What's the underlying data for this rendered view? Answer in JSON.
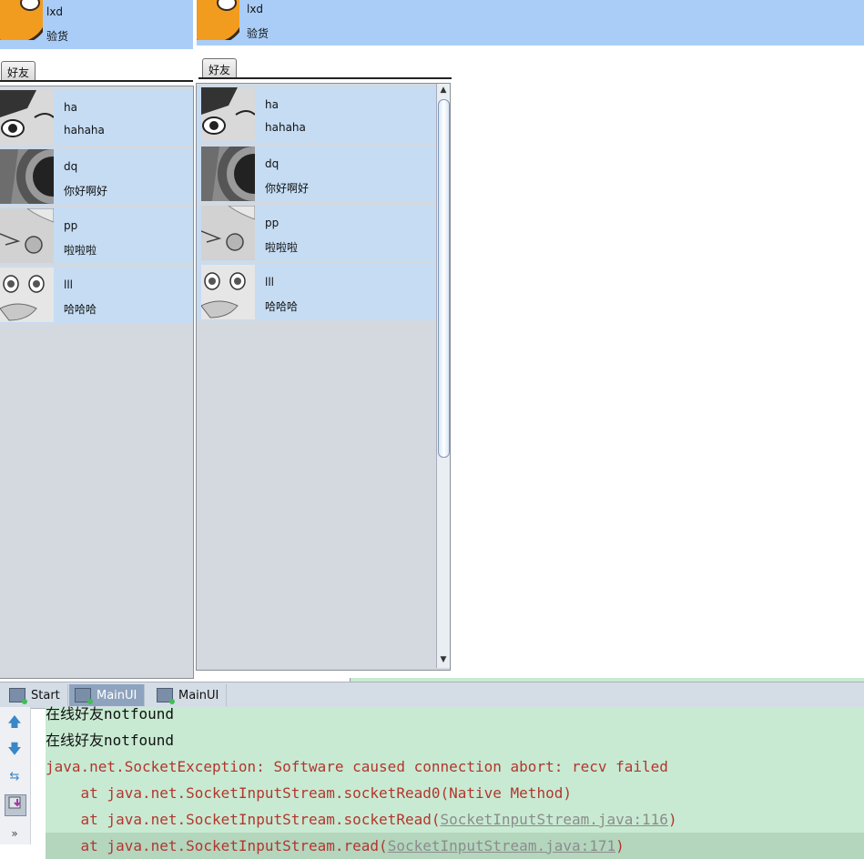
{
  "windows": [
    {
      "header": {
        "name": "lxd",
        "signature": "验货"
      },
      "tab_label": "好友",
      "friends": [
        {
          "name": "ha",
          "status": "hahaha"
        },
        {
          "name": "dq",
          "status": "你好啊好"
        },
        {
          "name": "pp",
          "status": "啦啦啦"
        },
        {
          "name": "lll",
          "status": "哈哈哈"
        }
      ]
    },
    {
      "header": {
        "name": "lxd",
        "signature": "验货"
      },
      "tab_label": "好友",
      "friends": [
        {
          "name": "ha",
          "status": "hahaha"
        },
        {
          "name": "dq",
          "status": "你好啊好"
        },
        {
          "name": "pp",
          "status": "啦啦啦"
        },
        {
          "name": "lll",
          "status": "哈哈哈"
        }
      ]
    }
  ],
  "run_panel": {
    "tabs": [
      {
        "label": "Start",
        "active": false
      },
      {
        "label": "MainUI",
        "active": true
      },
      {
        "label": "MainUI",
        "active": false
      }
    ],
    "console_lines": [
      {
        "prefix": "在线好友notfound",
        "link": "",
        "suffix": ""
      },
      {
        "prefix": "在线好友notfound",
        "link": "",
        "suffix": ""
      },
      {
        "prefix": "java.net.SocketException: Software caused connection abort: recv failed",
        "link": "",
        "suffix": ""
      },
      {
        "prefix": "    at java.net.SocketInputStream.socketRead0(Native Method)",
        "link": "",
        "suffix": ""
      },
      {
        "prefix": "    at java.net.SocketInputStream.socketRead(",
        "link": "SocketInputStream.java:116",
        "suffix": ")"
      },
      {
        "prefix": "    at java.net.SocketInputStream.read(",
        "link": "SocketInputStream.java:171",
        "suffix": ")"
      }
    ],
    "gutter_icons": [
      "arrow-up-icon",
      "arrow-down-icon",
      "soft-wrap-icon",
      "scroll-to-end-icon",
      "more-icon"
    ],
    "colors": {
      "console_bg": "#c8ead2",
      "error_text": "#b3362e",
      "header_bg": "#a9cdf7",
      "item_bg": "#c5dcf3"
    }
  }
}
